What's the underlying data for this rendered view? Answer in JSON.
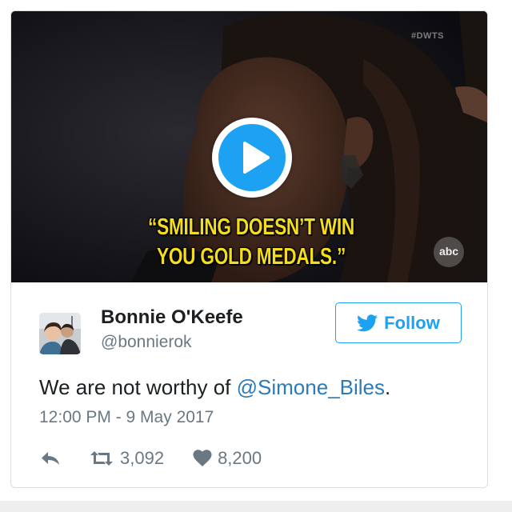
{
  "media": {
    "watermark": "#DWTS",
    "caption_line1": "“SMILING DOESN’T WIN",
    "caption_line2": "YOU GOLD MEDALS.”",
    "network_logo": "abc",
    "play_icon": "play-icon"
  },
  "author": {
    "name": "Bonnie O'Keefe",
    "handle": "@bonnierok",
    "avatar_icon": "avatar-photo"
  },
  "follow_button": {
    "label": "Follow",
    "icon": "twitter-bird-icon"
  },
  "tweet": {
    "text_before": "We are not worthy of ",
    "mention": "@Simone_Biles",
    "text_after": ".",
    "timestamp": "12:00 PM - 9 May 2017"
  },
  "actions": {
    "reply_icon": "reply-icon",
    "retweet_icon": "retweet-icon",
    "retweet_count": "3,092",
    "like_icon": "heart-icon",
    "like_count": "8,200"
  },
  "colors": {
    "accent": "#1da1f2",
    "mention": "#2b7bb9",
    "text_primary": "#1c2022",
    "text_secondary": "#697882",
    "caption": "#f4dc1e"
  }
}
